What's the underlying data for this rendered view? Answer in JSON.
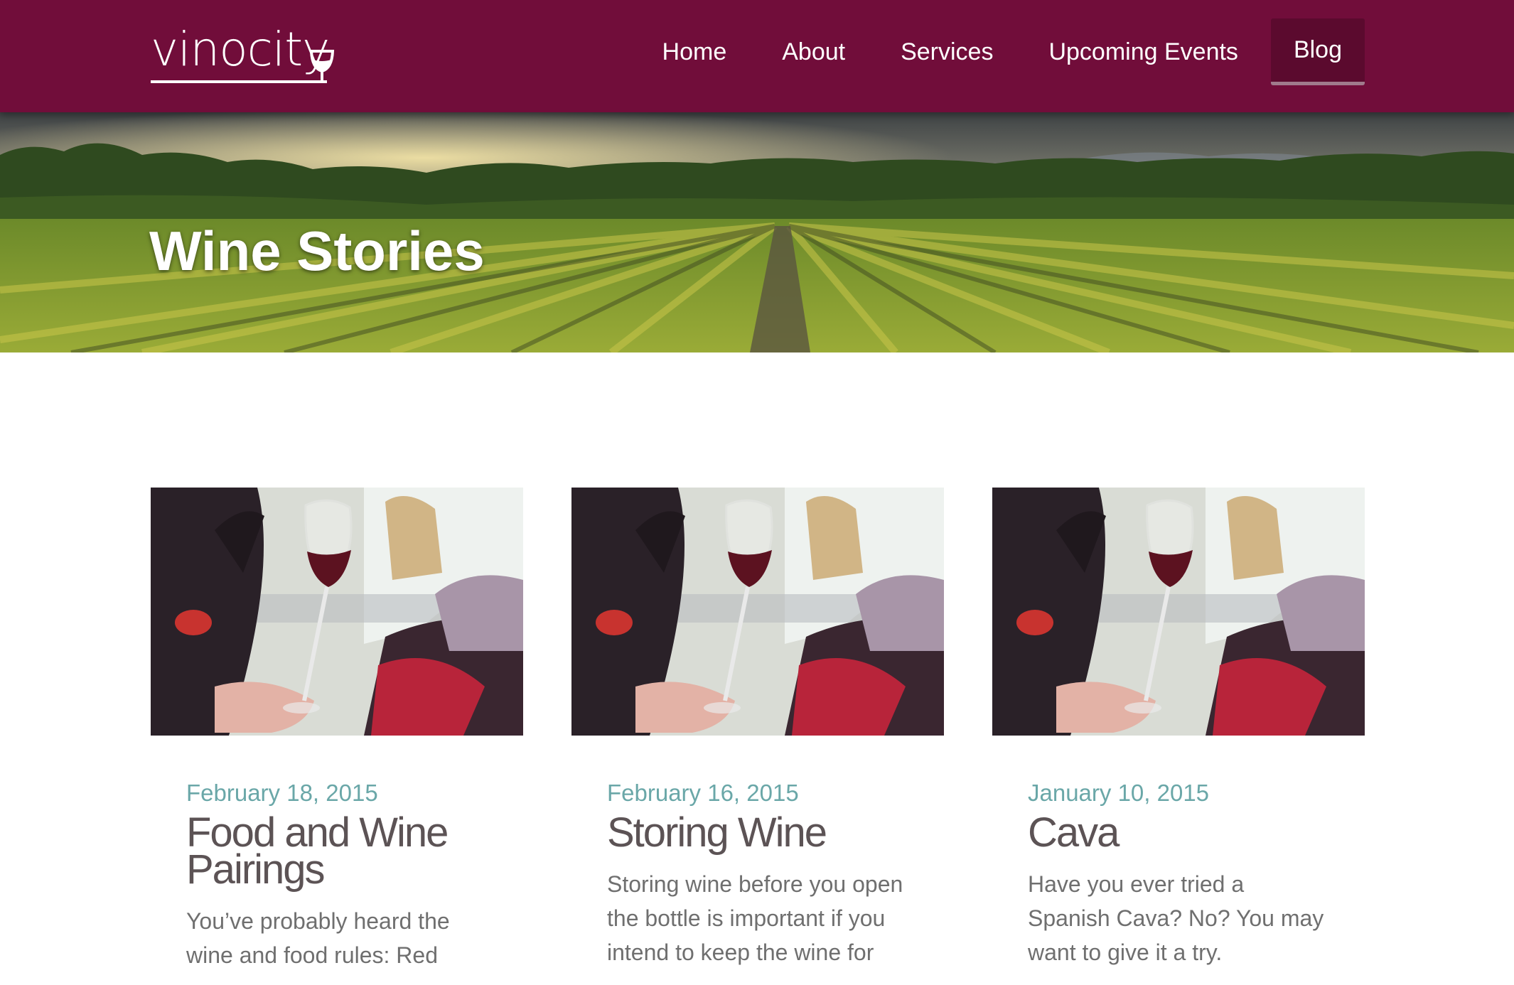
{
  "brand": {
    "logo_text": "vinocity",
    "accent_color": "#710d3a"
  },
  "nav": {
    "items": [
      {
        "label": "Home"
      },
      {
        "label": "About"
      },
      {
        "label": "Services"
      },
      {
        "label": "Upcoming Events"
      },
      {
        "label": "Blog",
        "active": true
      }
    ]
  },
  "hero": {
    "title": "Wine Stories",
    "image": "vineyard-photo"
  },
  "posts": [
    {
      "date": "February 18, 2015",
      "title": "Food and Wine Pairings",
      "excerpt": "You’ve probably heard the wine and food rules: Red",
      "image": "wine-glass-photo"
    },
    {
      "date": "February 16, 2015",
      "title": "Storing Wine",
      "excerpt": "Storing wine before you open the bottle is important if you intend to keep the wine for",
      "image": "wine-glass-photo"
    },
    {
      "date": "January 10, 2015",
      "title": "Cava",
      "excerpt": "Have you ever tried a Spanish Cava?  No?  You may want to give it a try.",
      "image": "wine-glass-photo"
    }
  ],
  "colors": {
    "header_bg": "#710d3a",
    "date_text": "#6aa7a8",
    "title_text": "#5c5355",
    "body_text": "#6f6f6f"
  }
}
